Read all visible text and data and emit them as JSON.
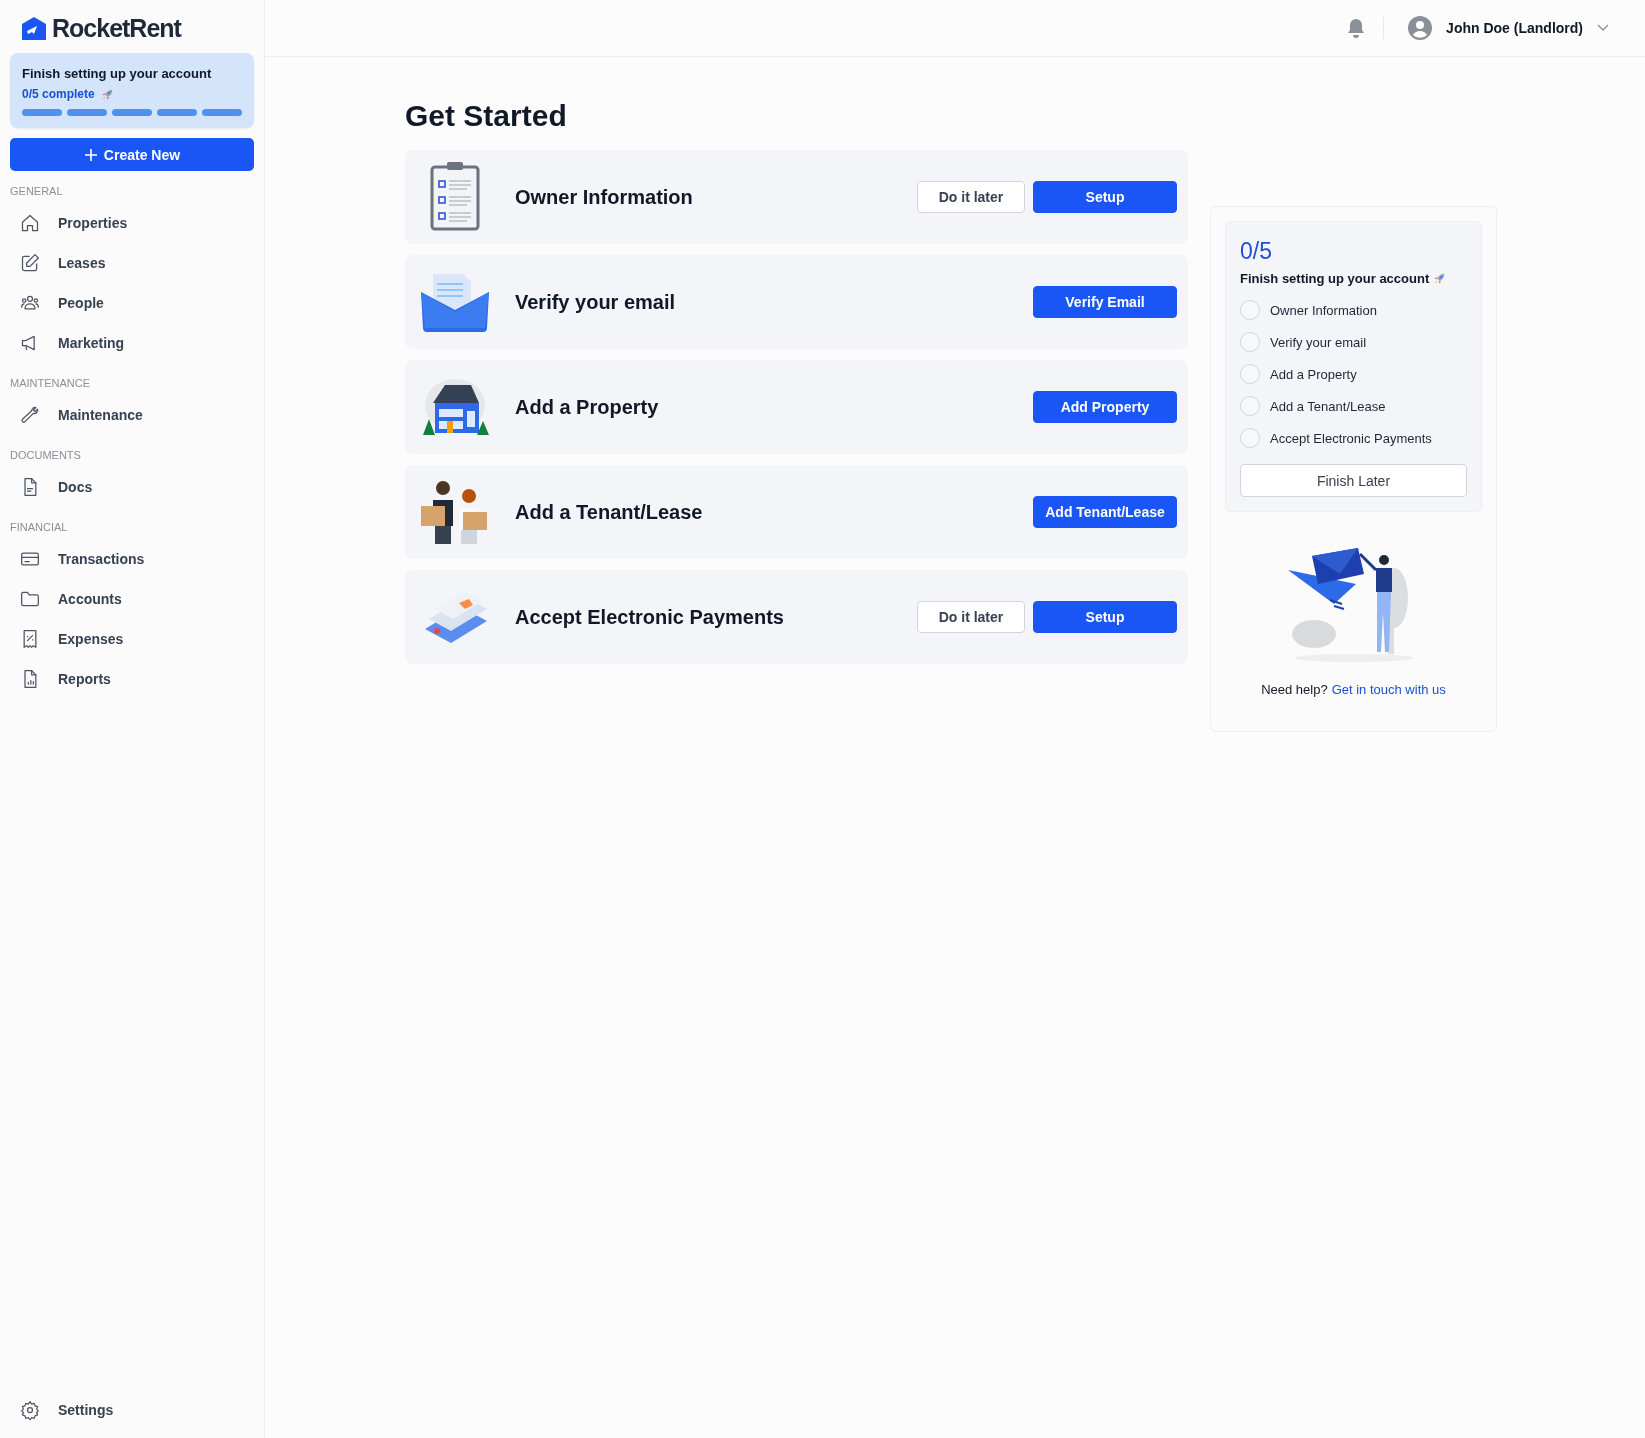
{
  "sidebar": {
    "logo": "RocketRent",
    "setup_card": {
      "title": "Finish setting up your account",
      "progress": "0/5 complete",
      "segments": [
        {
          "complete": false
        },
        {
          "complete": false
        },
        {
          "complete": false
        },
        {
          "complete": false
        },
        {
          "complete": false
        }
      ]
    },
    "create_button": "Create New",
    "sections": [
      {
        "heading": "GENERAL",
        "items": [
          {
            "label": "Properties",
            "selected": false
          },
          {
            "label": "Leases",
            "selected": false
          },
          {
            "label": "People",
            "selected": false
          },
          {
            "label": "Marketing",
            "selected": false
          }
        ]
      },
      {
        "heading": "MAINTENANCE",
        "items": [
          {
            "label": "Maintenance",
            "selected": false
          }
        ]
      },
      {
        "heading": "DOCUMENTS",
        "items": [
          {
            "label": "Docs",
            "selected": false
          }
        ]
      },
      {
        "heading": "FINANCIAL",
        "items": [
          {
            "label": "Transactions",
            "selected": false
          },
          {
            "label": "Accounts",
            "selected": false
          },
          {
            "label": "Expenses",
            "selected": false
          },
          {
            "label": "Reports",
            "selected": false
          }
        ]
      }
    ],
    "settings": "Settings"
  },
  "header": {
    "user": "John Doe (Landlord)"
  },
  "page_title": "Get Started",
  "tasks": [
    {
      "title": "Owner Information",
      "buttons": [
        {
          "label": "Do it later",
          "kind": "secondary"
        },
        {
          "label": "Setup",
          "kind": "primary"
        }
      ]
    },
    {
      "title": "Verify your email",
      "buttons": [
        {
          "label": "Verify Email",
          "kind": "primary"
        }
      ]
    },
    {
      "title": "Add a Property",
      "buttons": [
        {
          "label": "Add Property",
          "kind": "primary"
        }
      ]
    },
    {
      "title": "Add a Tenant/Lease",
      "buttons": [
        {
          "label": "Add Tenant/Lease",
          "kind": "primary"
        }
      ]
    },
    {
      "title": "Accept Electronic Payments",
      "buttons": [
        {
          "label": "Do it later",
          "kind": "secondary"
        },
        {
          "label": "Setup",
          "kind": "primary"
        }
      ]
    }
  ],
  "checklist_panel": {
    "count": "0/5",
    "title": "Finish setting up your account",
    "items": [
      {
        "label": "Owner Information",
        "checked": false
      },
      {
        "label": "Verify your email",
        "checked": false
      },
      {
        "label": "Add a Property",
        "checked": false
      },
      {
        "label": "Add a Tenant/Lease",
        "checked": false
      },
      {
        "label": "Accept Electronic Payments",
        "checked": false
      }
    ],
    "finish_button": "Finish Later",
    "help_text": "Need help?",
    "help_link": "Get in touch with us"
  }
}
